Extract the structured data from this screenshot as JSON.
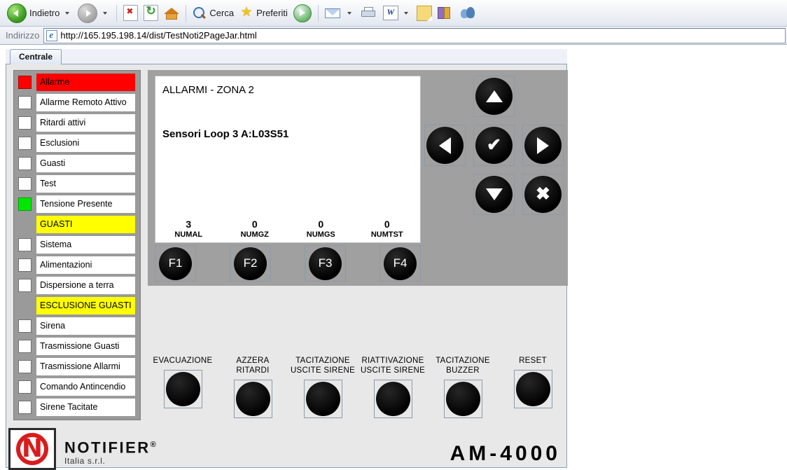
{
  "browser": {
    "back_label": "Indietro",
    "search_label": "Cerca",
    "favorites_label": "Preferiti",
    "address_label": "Indirizzo",
    "url": "http://165.195.198.14/dist/TestNoti2PageJar.html",
    "icons": {
      "back": "back-arrow-icon",
      "forward": "forward-arrow-icon",
      "stop": "stop-icon",
      "refresh": "refresh-icon",
      "home": "home-icon",
      "search": "search-icon",
      "favorites": "star-icon",
      "media": "media-icon",
      "mail": "mail-icon",
      "print": "printer-icon",
      "word": "word-icon",
      "notes": "note-icon",
      "research": "book-research-icon",
      "messenger": "messenger-icon"
    }
  },
  "tabs": [
    {
      "label": "Centrale",
      "active": true
    }
  ],
  "led_panel": {
    "rows": [
      {
        "label": "Allarme",
        "led": "red",
        "highlight": "alarm"
      },
      {
        "label": "Allarme Remoto Attivo",
        "led": "off",
        "highlight": "none"
      },
      {
        "label": "Ritardi attivi",
        "led": "off",
        "highlight": "none"
      },
      {
        "label": "Esclusioni",
        "led": "off",
        "highlight": "none"
      },
      {
        "label": "Guasti",
        "led": "off",
        "highlight": "none"
      },
      {
        "label": "Test",
        "led": "off",
        "highlight": "none"
      },
      {
        "label": "Tensione Presente",
        "led": "green",
        "highlight": "none"
      },
      {
        "label": "GUASTI",
        "led": "none",
        "highlight": "header"
      },
      {
        "label": "Sistema",
        "led": "off",
        "highlight": "none"
      },
      {
        "label": "Alimentazioni",
        "led": "off",
        "highlight": "none"
      },
      {
        "label": "Dispersione a terra",
        "led": "off",
        "highlight": "none"
      },
      {
        "label": "ESCLUSIONE GUASTI",
        "led": "none",
        "highlight": "header"
      },
      {
        "label": "Sirena",
        "led": "off",
        "highlight": "none"
      },
      {
        "label": "Trasmissione Guasti",
        "led": "off",
        "highlight": "none"
      },
      {
        "label": "Trasmissione Allarmi",
        "led": "off",
        "highlight": "none"
      },
      {
        "label": "Comando Antincendio",
        "led": "off",
        "highlight": "none"
      },
      {
        "label": "Sirene Tacitate",
        "led": "off",
        "highlight": "none"
      }
    ],
    "colors": {
      "alarm_red": "#ff0000",
      "ok_green": "#00e800",
      "header_yellow": "#ffff00",
      "panel_gray": "#9a9a9a"
    }
  },
  "lcd": {
    "line1": "ALLARMI - ZONA 2",
    "line2": "Sensori Loop 3 A:L03S51",
    "counters": [
      {
        "value": "3",
        "name": "NUMAL"
      },
      {
        "value": "0",
        "name": "NUMGZ"
      },
      {
        "value": "0",
        "name": "NUMGS"
      },
      {
        "value": "0",
        "name": "NUMTST"
      }
    ]
  },
  "keypad": {
    "up": "arrow-up-icon",
    "left": "arrow-left-icon",
    "ok": "✔",
    "right": "arrow-right-icon",
    "down": "arrow-down-icon",
    "cancel": "✖"
  },
  "fkeys": [
    {
      "label": "F1"
    },
    {
      "label": "F2"
    },
    {
      "label": "F3"
    },
    {
      "label": "F4"
    }
  ],
  "function_buttons": [
    {
      "line1": "EVACUAZIONE",
      "line2": ""
    },
    {
      "line1": "AZZERA",
      "line2": "RITARDI"
    },
    {
      "line1": "TACITAZIONE",
      "line2": "USCITE SIRENE"
    },
    {
      "line1": "RIATTIVAZIONE",
      "line2": "USCITE SIRENE"
    },
    {
      "line1": "TACITAZIONE",
      "line2": "BUZZER"
    },
    {
      "line1": "RESET",
      "line2": ""
    }
  ],
  "branding": {
    "logo": "notifier-n-logo",
    "name": "NOTIFIER",
    "registered": "®",
    "tagline": "Italia s.r.l.",
    "model": "AM-4000"
  }
}
